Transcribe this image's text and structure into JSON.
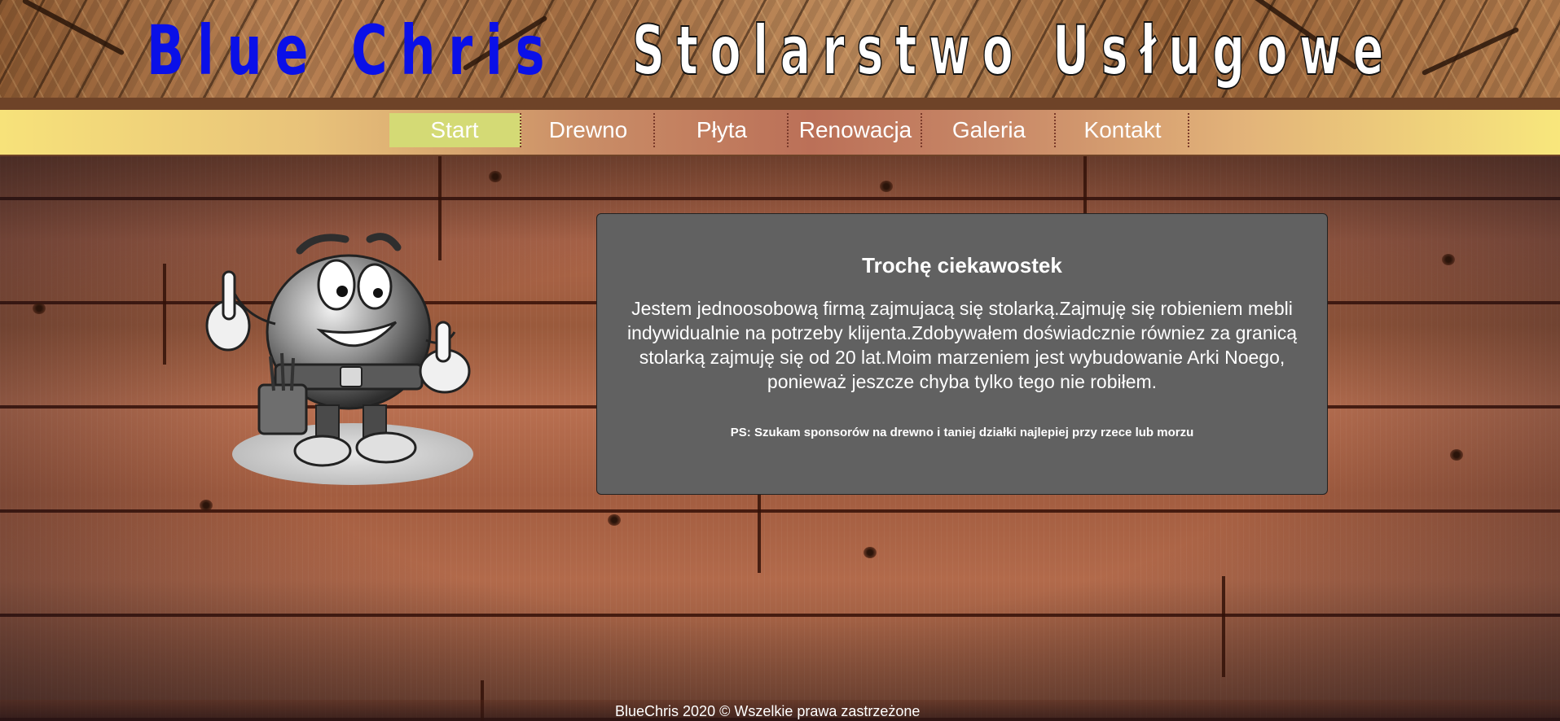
{
  "header": {
    "brand_name": "Blue Chris",
    "tagline": "Stolarstwo Usługowe"
  },
  "nav": {
    "items": [
      {
        "label": "Start",
        "active": true
      },
      {
        "label": "Drewno",
        "active": false
      },
      {
        "label": "Płyta",
        "active": false
      },
      {
        "label": "Renowacja",
        "active": false
      },
      {
        "label": "Galeria",
        "active": false
      },
      {
        "label": "Kontakt",
        "active": false
      }
    ]
  },
  "card": {
    "title": "Trochę ciekawostek",
    "body": "Jestem jednoosobową firmą zajmujacą się stolarką.Zajmuję się robieniem mebli indywidualnie na potrzeby klijenta.Zdobywałem doświadcznie równiez za granicą stolarką zajmuję się od 20 lat.Moim marzeniem jest wybudowanie Arki Noego, ponieważ jeszcze chyba tylko tego nie robiłem.",
    "ps": "PS: Szukam sponsorów na drewno i taniej działki najlepiej przy rzece lub morzu"
  },
  "footer": {
    "copyright": "BlueChris 2020 © Wszelkie prawa zastrzeżone"
  },
  "colors": {
    "brand_blue": "#0a10e8",
    "nav_active": "#d4da75",
    "card_bg": "#616161"
  },
  "icons": {
    "mascot": "carpenter-mascot-illustration"
  }
}
